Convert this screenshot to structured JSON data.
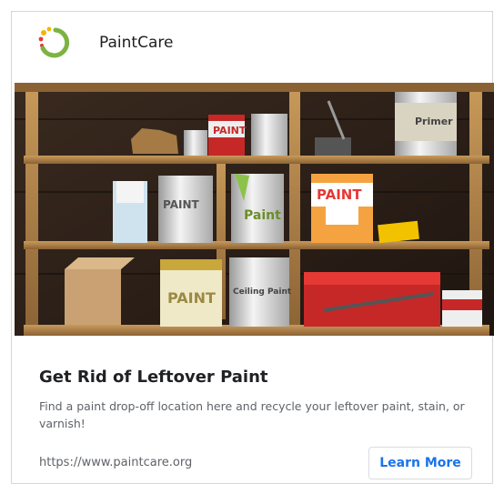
{
  "brand": {
    "name": "PaintCare",
    "logo_colors": [
      "#f4b400",
      "#e53935",
      "#7cb342"
    ]
  },
  "hero": {
    "can_labels": [
      "PAINT",
      "PAINT",
      "Paint",
      "PAINT",
      "Ceiling Paint",
      "PAINT",
      "Primer"
    ]
  },
  "ad": {
    "title": "Get Rid of Leftover Paint",
    "description": "Find a paint drop-off location here and recycle your leftover paint, stain, or varnish!",
    "url": "https://www.paintcare.org",
    "cta_label": "Learn More"
  },
  "colors": {
    "cta": "#1a73e8",
    "title": "#202124",
    "body_text": "#5f6368"
  }
}
